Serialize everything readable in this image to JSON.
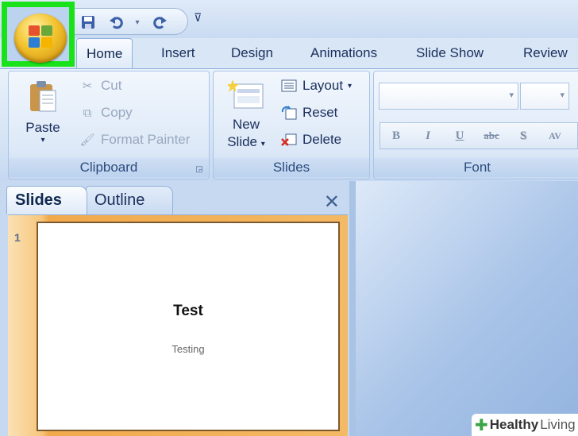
{
  "app": {
    "brand_colors": {
      "highlight": "#19e21b",
      "ribbon": "#d3e2f5",
      "pane_accent": "#f1a94b"
    }
  },
  "quick_access": {
    "icons": [
      "save-icon",
      "undo-icon",
      "undo-dropdown-icon",
      "redo-icon",
      "customize-dropdown-icon"
    ]
  },
  "tabs": [
    {
      "label": "Home",
      "active": true
    },
    {
      "label": "Insert"
    },
    {
      "label": "Design"
    },
    {
      "label": "Animations"
    },
    {
      "label": "Slide Show"
    },
    {
      "label": "Review"
    }
  ],
  "clipboard": {
    "paste": "Paste",
    "cut": "Cut",
    "copy": "Copy",
    "format_painter": "Format Painter",
    "label": "Clipboard"
  },
  "slides_group": {
    "new_slide_line1": "New",
    "new_slide_line2": "Slide",
    "layout": "Layout",
    "reset": "Reset",
    "delete": "Delete",
    "label": "Slides"
  },
  "font_group": {
    "label": "Font",
    "format_buttons": [
      "B",
      "I",
      "U",
      "abc",
      "S",
      "AV"
    ]
  },
  "pane": {
    "tab_slides": "Slides",
    "tab_outline": "Outline",
    "thumbnail_number": "1",
    "slide_title": "Test",
    "slide_subtitle": "Testing"
  },
  "watermark": {
    "bold": "Healthy",
    "light": "Living"
  }
}
